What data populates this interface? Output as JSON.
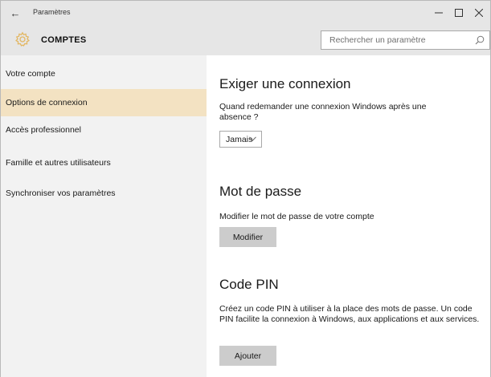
{
  "window": {
    "title": "Paramètres",
    "back_glyph": "←",
    "controls": [
      "minimize-icon",
      "maximize-icon",
      "close-icon"
    ]
  },
  "header": {
    "icon": "gear-icon",
    "accent_color": "#e3b763",
    "title": "COMPTES",
    "search_placeholder": "Rechercher un paramètre",
    "search_value": ""
  },
  "sidebar": {
    "background": "#f2f2f2",
    "active_color": "#f3e2c2",
    "items": [
      {
        "label": "Votre compte"
      },
      {
        "label": "Options de connexion",
        "active": true
      },
      {
        "label": "Accès professionnel"
      },
      {
        "label": "Famille et autres utilisateurs"
      },
      {
        "label": "Synchroniser vos paramètres"
      }
    ]
  },
  "main": {
    "signin": {
      "title": "Exiger une connexion",
      "question": "Quand redemander une connexion Windows après une absence ?",
      "select_value": "Jamais"
    },
    "password": {
      "title": "Mot de passe",
      "description": "Modifier le mot de passe de votre compte",
      "button_label": "Modifier"
    },
    "pin": {
      "title": "Code PIN",
      "description": "Créez un code PIN à utiliser à la place des mots de passe. Un code PIN facilite la connexion à Windows, aux applications et aux services.",
      "button_label": "Ajouter"
    }
  }
}
